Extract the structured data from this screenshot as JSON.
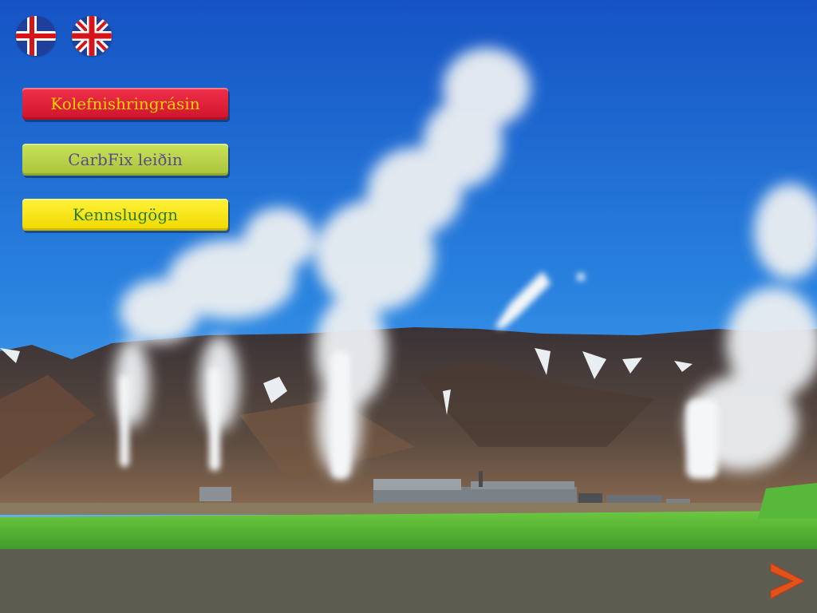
{
  "languages": [
    {
      "code": "is",
      "icon": "iceland-flag-icon"
    },
    {
      "code": "en",
      "icon": "uk-flag-icon"
    }
  ],
  "menu": {
    "carbon_cycle": {
      "label": "Kolefnishringrásin",
      "bg": "#e0203a",
      "text_color": "#ffd200"
    },
    "carbfix": {
      "label": "CarbFix leiðin",
      "bg": "#b8d34a",
      "text_color": "#5a4a8a"
    },
    "teaching": {
      "label": "Kennslugögn",
      "bg": "#ffe81a",
      "text_color": "#2f7d1a"
    }
  },
  "navigation": {
    "next_icon": "chevron-right-icon",
    "next_color": "#e2521a"
  },
  "colors": {
    "bottom_bar": "#5d5c50",
    "sky": "#1e6fd8",
    "grass": "#57b83a"
  }
}
